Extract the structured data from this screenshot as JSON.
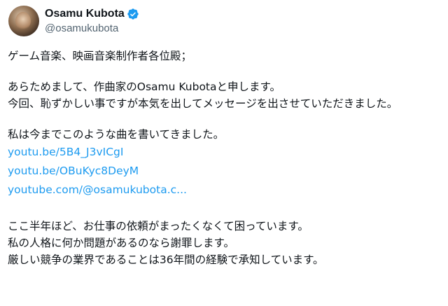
{
  "author": {
    "display_name": "Osamu Kubota",
    "handle": "@osamukubota",
    "avatar_icon": "user-avatar-photo",
    "verified_icon": "verified-badge-icon",
    "verified_color": "#1d9bf0"
  },
  "tweet": {
    "greeting": "ゲーム音楽、映画音楽制作者各位殿；",
    "intro_line": "あらためまして、作曲家のOsamu Kubotaと申します。",
    "request_line": "今回、恥ずかしい事ですが本気を出してメッセージを出させていただきました。",
    "works_intro": "私は今までこのような曲を書いてきました。",
    "links": [
      "youtu.be/5B4_J3vICgI",
      "youtu.be/OBuKyc8DeyM",
      "youtube.com/@osamukubota.c..."
    ],
    "closing_lines": [
      "ここ半年ほど、お仕事の依頼がまったくなくて困っています。",
      "私の人格に何か問題があるのなら謝罪します。",
      "厳しい競争の業界であることは36年間の経験で承知しています。"
    ]
  },
  "colors": {
    "text": "#0f1419",
    "secondary": "#536471",
    "link": "#1d9bf0"
  }
}
